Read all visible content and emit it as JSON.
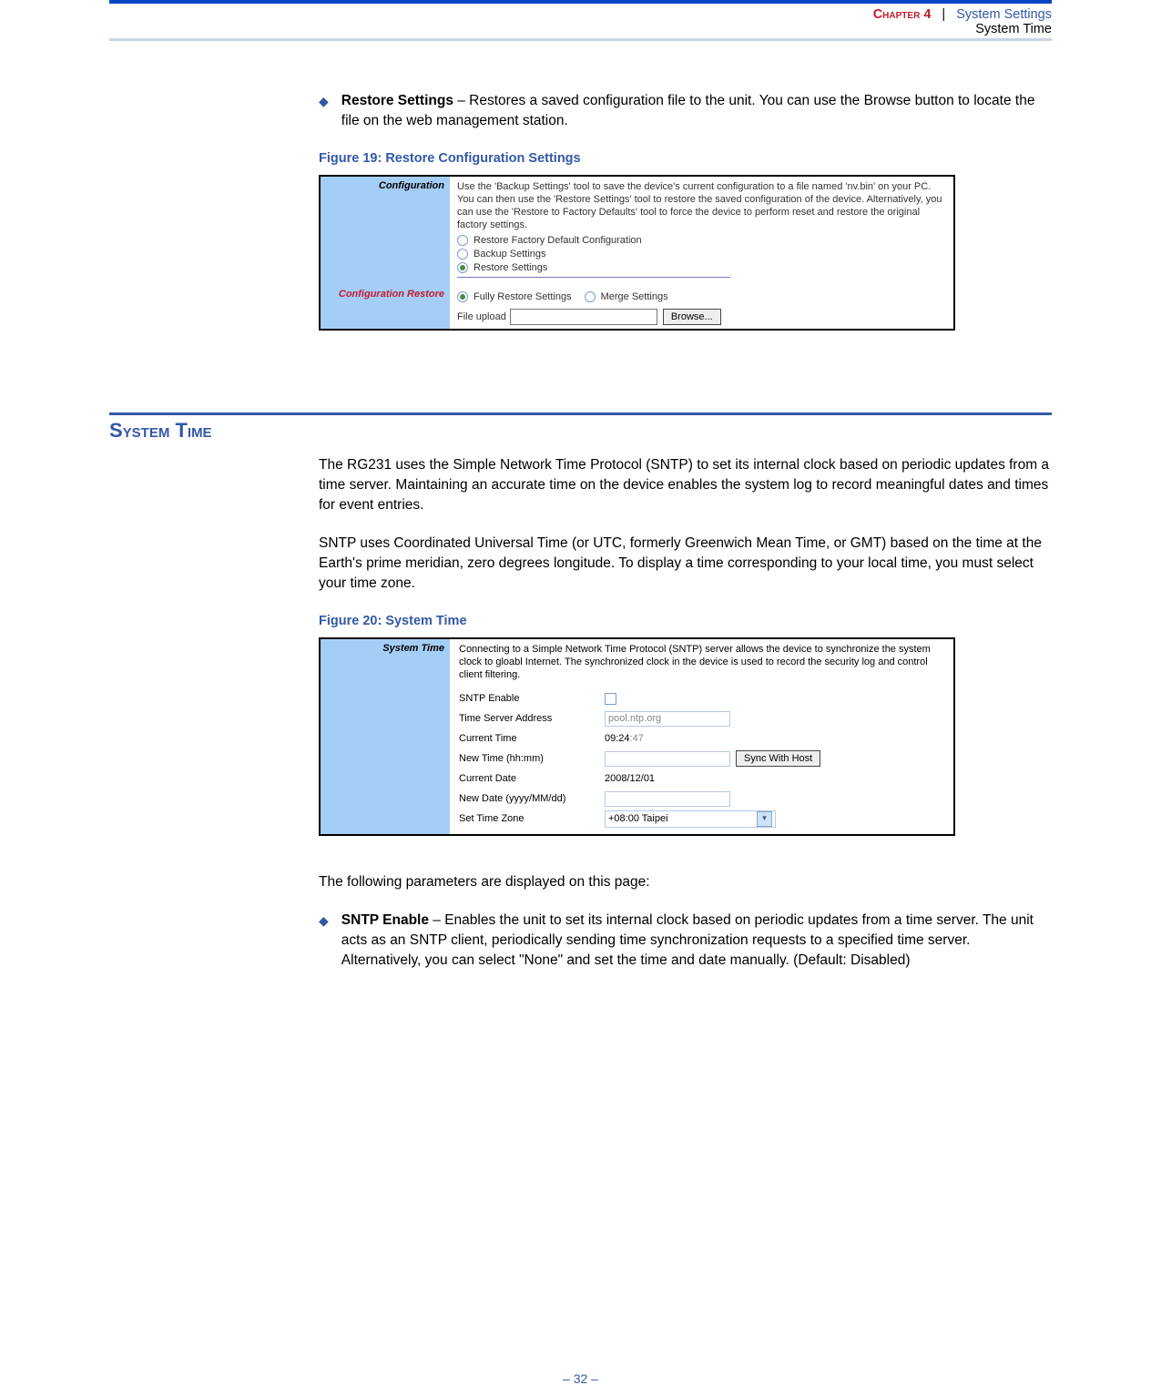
{
  "header": {
    "chapter": "Chapter 4",
    "sep": "|",
    "title": "System Settings",
    "subtitle": "System Time"
  },
  "restore_bullet": {
    "title": "Restore Settings",
    "desc": " – Restores a saved configuration file to the unit. You can use the Browse button to locate the file on the web management station."
  },
  "fig19": {
    "caption": "Figure 19:  Restore Configuration Settings",
    "left1": "Configuration",
    "intro": "Use the 'Backup Settings' tool to save the device's current configuration to a file named 'nv.bin' on your PC. You can then use the 'Restore Settings' tool to restore the saved configuration of the device. Alternatively, you can use the 'Restore to Factory Defaults' tool to force the device to perform reset and restore the original factory settings.",
    "opt1": "Restore Factory Default Configuration",
    "opt2": "Backup Settings",
    "opt3": "Restore Settings",
    "left2": "Configuration Restore",
    "sub_opt1": "Fully Restore Settings",
    "sub_opt2": "Merge Settings",
    "fileupload_label": "File upload",
    "browse": "Browse..."
  },
  "section": {
    "heading": "System Time",
    "para1": "The RG231 uses the Simple Network Time Protocol (SNTP) to set its internal clock based on periodic updates from a time server. Maintaining an accurate time on the device enables the system log to record meaningful dates and times for event entries.",
    "para2": "SNTP uses Coordinated Universal Time (or UTC, formerly Greenwich Mean Time, or GMT) based on the time at the Earth's prime meridian, zero degrees longitude. To display a time corresponding to your local time, you must select your time zone."
  },
  "fig20": {
    "caption": "Figure 20:  System Time",
    "left": "System Time",
    "intro": "Connecting to a Simple Network Time Protocol (SNTP) server allows the device to synchronize the system clock to gloabl Internet. The synchronized clock in the device is used to record the security log and control client filtering.",
    "rows": {
      "sntp_label": "SNTP Enable",
      "tsa_label": "Time Server Address",
      "tsa_value": "pool.ntp.org",
      "curtime_label": "Current Time",
      "curtime_value": "09:24:47",
      "newtime_label": "New Time (hh:mm)",
      "sync_btn": "Sync With Host",
      "curdate_label": "Current Date",
      "curdate_value": "2008/12/01",
      "newdate_label": "New Date (yyyy/MM/dd)",
      "tz_label": "Set Time Zone",
      "tz_value": "+08:00 Taipei"
    }
  },
  "post_fig_para": "The following parameters are displayed on this page:",
  "sntp_bullet": {
    "title": "SNTP Enable",
    "desc": " – Enables the unit to set its internal clock based on periodic updates from a time server. The unit acts as an SNTP client, periodically sending time synchronization requests to a specified time server. Alternatively, you can select \"None\" and set the time and date manually. (Default: Disabled)"
  },
  "footer": "–  32  –"
}
